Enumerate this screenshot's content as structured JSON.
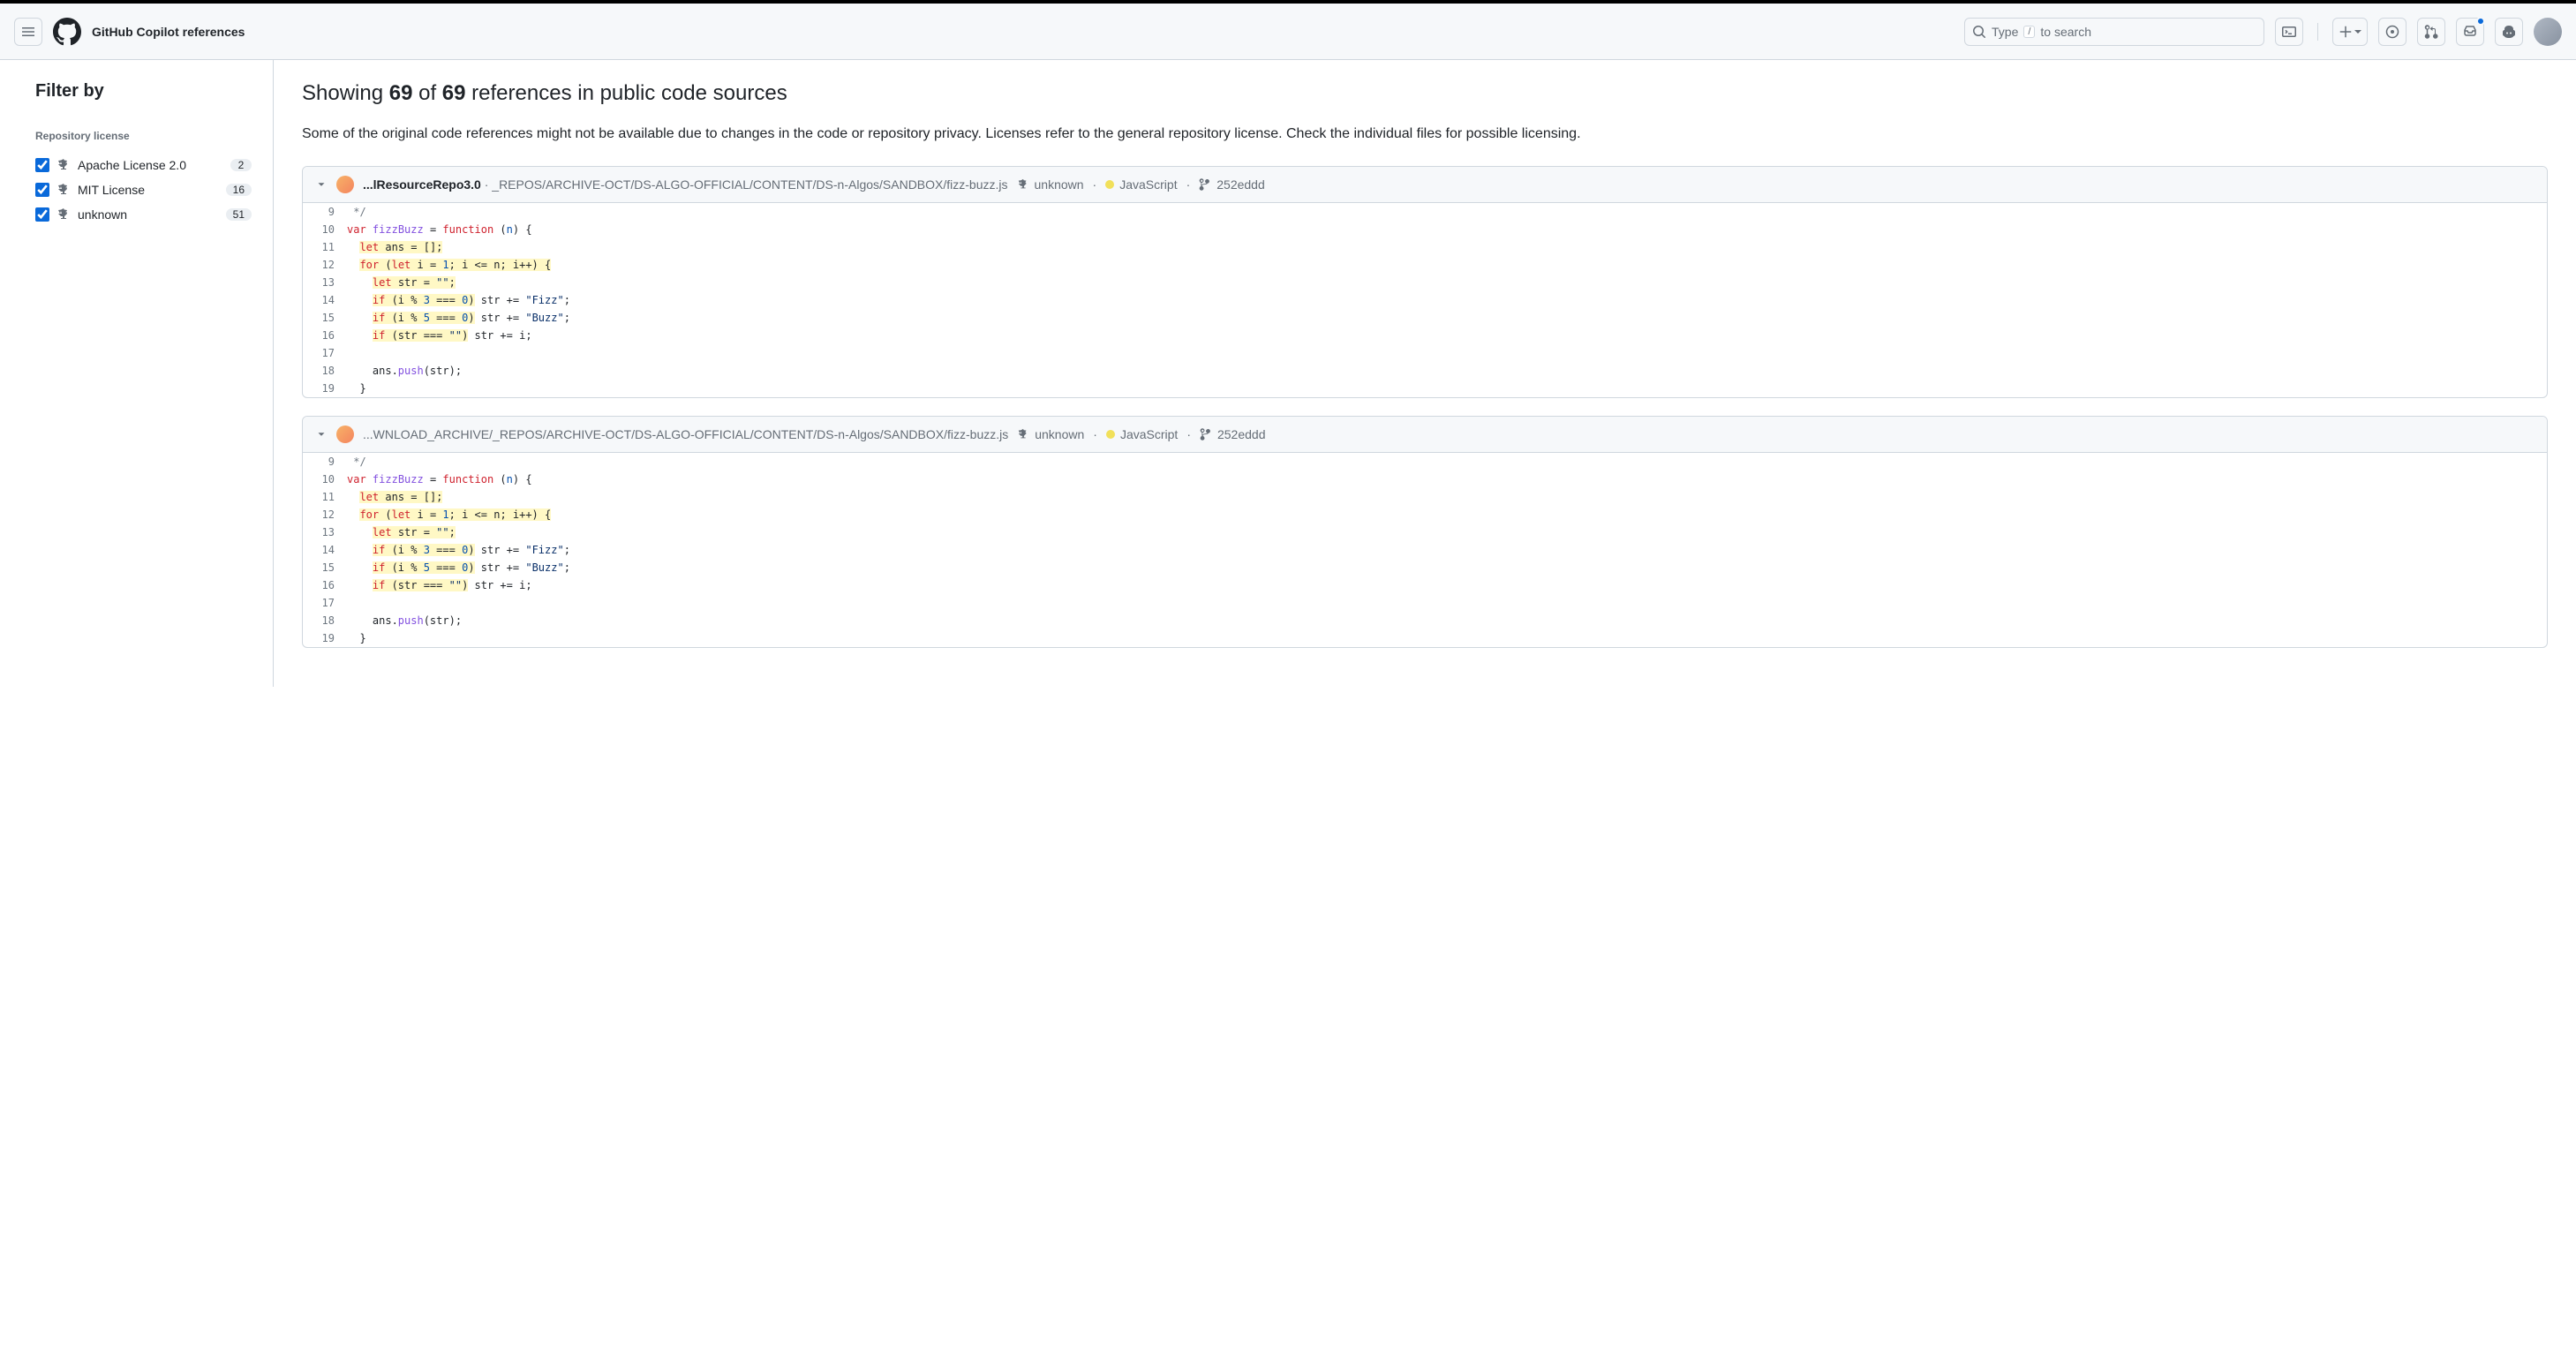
{
  "header": {
    "title": "GitHub Copilot references",
    "search_placeholder": "Type",
    "search_hint": "to search",
    "search_kbd": "/"
  },
  "sidebar": {
    "title": "Filter by",
    "section_title": "Repository license",
    "filters": [
      {
        "label": "Apache License 2.0",
        "count": "2",
        "checked": true
      },
      {
        "label": "MIT License",
        "count": "16",
        "checked": true
      },
      {
        "label": "unknown",
        "count": "51",
        "checked": true
      }
    ]
  },
  "results": {
    "showing": "Showing",
    "count": "69",
    "of": "of",
    "total": "69",
    "suffix": "references in public code sources",
    "note": "Some of the original code references might not be available due to changes in the code or repository privacy. Licenses refer to the general repository license. Check the individual files for possible licensing."
  },
  "cards": [
    {
      "repo": "...lResourceRepo3.0",
      "sep": " · ",
      "path": "_REPOS/ARCHIVE-OCT/DS-ALGO-OFFICIAL/CONTENT/DS-n-Algos/SANDBOX/fizz-buzz.js",
      "license": "unknown",
      "language": "JavaScript",
      "branch": "252eddd"
    },
    {
      "repo": "",
      "sep": "",
      "path": "...WNLOAD_ARCHIVE/_REPOS/ARCHIVE-OCT/DS-ALGO-OFFICIAL/CONTENT/DS-n-Algos/SANDBOX/fizz-buzz.js",
      "license": "unknown",
      "language": "JavaScript",
      "branch": "252eddd"
    }
  ],
  "code": {
    "lines": [
      "9",
      "10",
      "11",
      "12",
      "13",
      "14",
      "15",
      "16",
      "17",
      "18",
      "19"
    ]
  }
}
